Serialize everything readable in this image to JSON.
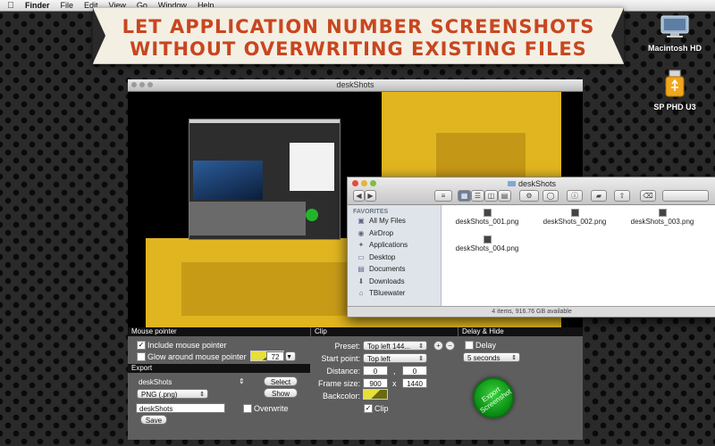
{
  "menubar": {
    "items": [
      "Finder",
      "File",
      "Edit",
      "View",
      "Go",
      "Window",
      "Help"
    ]
  },
  "banner": {
    "line1": "LET APPLICATION NUMBER SCREENSHOTS",
    "line2": "WITHOUT OVERWRITING EXISTING FILES"
  },
  "desktop_icons": {
    "hd": "Macintosh HD",
    "usb": "SP PHD U3"
  },
  "shot_window": {
    "title": "deskShots"
  },
  "finder": {
    "title": "deskShots",
    "sidebar_header": "FAVORITES",
    "sidebar": [
      {
        "label": "All My Files",
        "icon": "files-icon"
      },
      {
        "label": "AirDrop",
        "icon": "airdrop-icon"
      },
      {
        "label": "Applications",
        "icon": "applications-icon"
      },
      {
        "label": "Desktop",
        "icon": "desktop-icon"
      },
      {
        "label": "Documents",
        "icon": "documents-icon"
      },
      {
        "label": "Downloads",
        "icon": "downloads-icon"
      },
      {
        "label": "TBluewater",
        "icon": "home-icon"
      }
    ],
    "files": [
      "deskShots_001.png",
      "deskShots_002.png",
      "deskShots_003.png",
      "deskShots_004.png"
    ],
    "status": "4 items, 916.76 GB available"
  },
  "panel": {
    "mouse": {
      "header": "Mouse pointer",
      "include": "Include mouse pointer",
      "glow": "Glow around mouse pointer",
      "size": "72"
    },
    "export": {
      "header": "Export",
      "folder": "deskShots",
      "select": "Select",
      "show": "Show",
      "format": "PNG (.png)",
      "filename": "deskShots",
      "save": "Save",
      "overwrite": "Overwrite"
    },
    "clip": {
      "header": "Clip",
      "preset_label": "Preset:",
      "preset": "Top left 144...",
      "start_label": "Start point:",
      "start": "Top left",
      "distance_label": "Distance:",
      "dist_x": "0",
      "dist_sep": ",",
      "dist_y": "0",
      "frame_label": "Frame size:",
      "frame_w": "900",
      "frame_sep": "x",
      "frame_h": "1440",
      "backcolor_label": "Backcolor:",
      "clip_check": "Clip"
    },
    "delay": {
      "header": "Delay & Hide",
      "delay_label": "Delay",
      "delay_value": "5 seconds"
    },
    "export_button": "Export Screenshot"
  }
}
